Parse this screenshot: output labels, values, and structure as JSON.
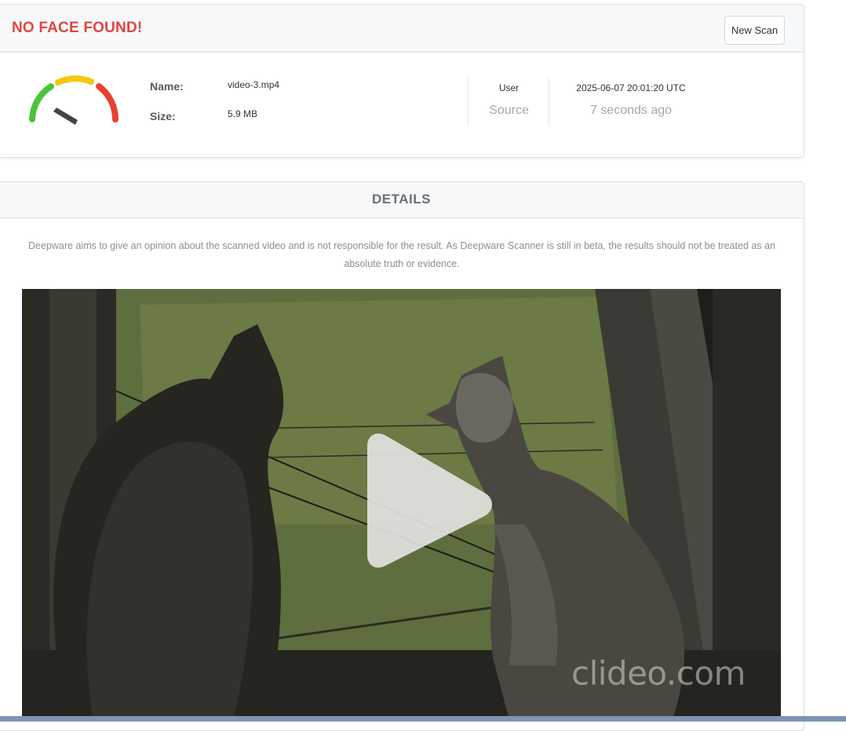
{
  "result": {
    "status_title": "NO FACE FOUND!",
    "new_scan_label": "New Scan",
    "name_label": "Name:",
    "name_value": "video-3.mp4",
    "size_label": "Size:",
    "size_value": "5.9 MB",
    "user_label": "User",
    "source_label": "Source",
    "timestamp": "2025-06-07 20:01:20 UTC",
    "relative_time": "7 seconds ago",
    "gauge": {
      "colors": [
        "#4cc43a",
        "#f5c80f",
        "#e8412f"
      ],
      "needle_color": "#444444",
      "icon": "risk-gauge-icon"
    },
    "title_color": "#e0463f"
  },
  "details": {
    "title": "DETAILS",
    "disclaimer": "Deepware aims to give an opinion about the scanned video and is not responsible for the result. As Deepware Scanner is still in beta, the results should not be treated as an absolute truth or evidence.",
    "video": {
      "watermark": "clideo.com",
      "play_icon": "play-icon"
    }
  }
}
